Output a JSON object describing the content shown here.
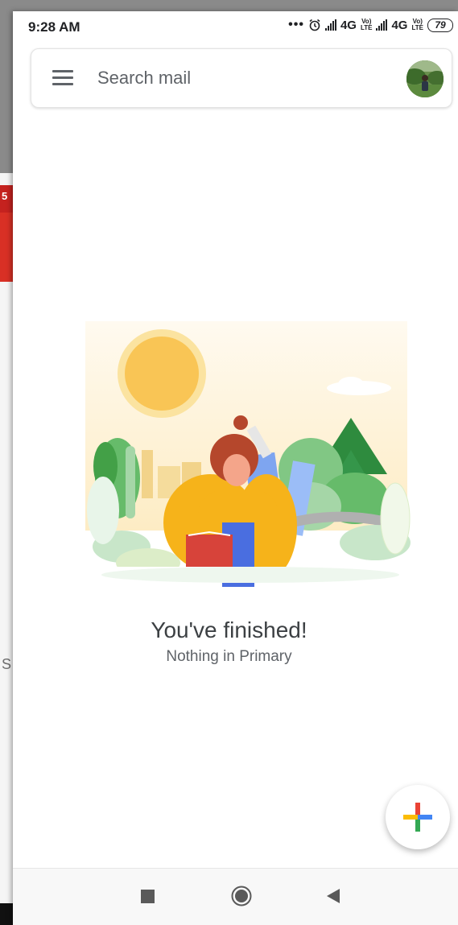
{
  "status_bar": {
    "time": "9:28 AM",
    "dots": "•••",
    "network1": "4G",
    "volte1_top": "Vo)",
    "volte1_bottom": "LTE",
    "network2": "4G",
    "volte2_top": "Vo)",
    "volte2_bottom": "LTE",
    "battery": "79",
    "icons": [
      "alarm-icon",
      "signal-icon",
      "signal-icon",
      "battery-icon"
    ]
  },
  "search": {
    "placeholder": "Search mail",
    "menu_icon": "hamburger-menu-icon",
    "avatar_icon": "profile-avatar"
  },
  "empty_state": {
    "title": "You've finished!",
    "subtitle": "Nothing in Primary"
  },
  "fab": {
    "icon": "compose-plus-icon"
  },
  "background_layer": {
    "badge": "5",
    "letter": "S"
  },
  "nav_bar": {
    "icons": [
      "recent-apps-icon",
      "home-icon",
      "back-icon"
    ]
  },
  "colors": {
    "google_red": "#ea4335",
    "google_blue": "#4285f4",
    "google_yellow": "#fbbc04",
    "google_green": "#34a853"
  }
}
